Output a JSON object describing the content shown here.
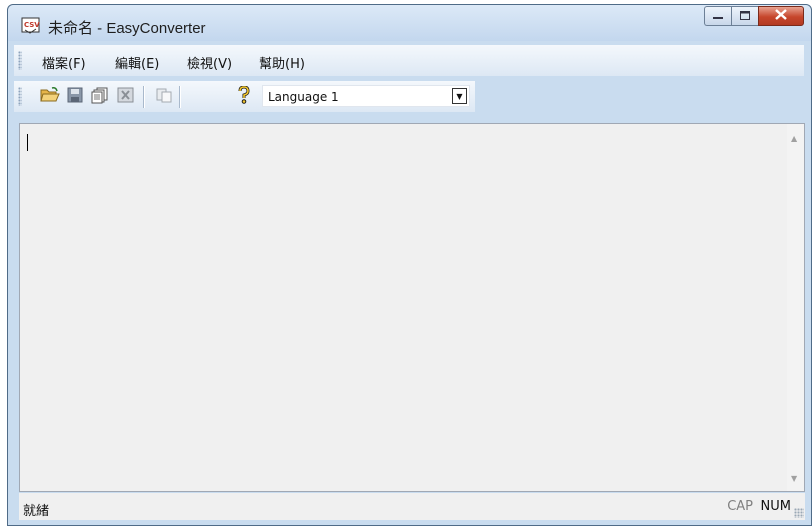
{
  "window": {
    "title": "未命名 - EasyConverter",
    "app_icon": "csv-file-icon",
    "controls": {
      "minimize": "minimize-icon",
      "maximize": "maximize-icon",
      "close": "close-icon"
    }
  },
  "menubar": {
    "items": [
      {
        "label": "檔案(F)"
      },
      {
        "label": "編輯(E)"
      },
      {
        "label": "檢視(V)"
      },
      {
        "label": "幫助(H)"
      }
    ]
  },
  "toolbar": {
    "buttons": [
      {
        "icon": "open-folder-icon"
      },
      {
        "icon": "save-disk-icon"
      },
      {
        "icon": "copy-pages-icon"
      },
      {
        "icon": "delete-icon"
      },
      {
        "icon": "paste-icon"
      },
      {
        "icon": "help-icon"
      }
    ],
    "language_select": {
      "selected": "Language 1"
    }
  },
  "editor": {
    "content": ""
  },
  "statusbar": {
    "text": "就緒",
    "cap": "CAP",
    "num": "NUM"
  },
  "colors": {
    "titlebar": "#c9dcef",
    "close_button": "#c6462c",
    "editor_bg": "#f0f0f0"
  }
}
